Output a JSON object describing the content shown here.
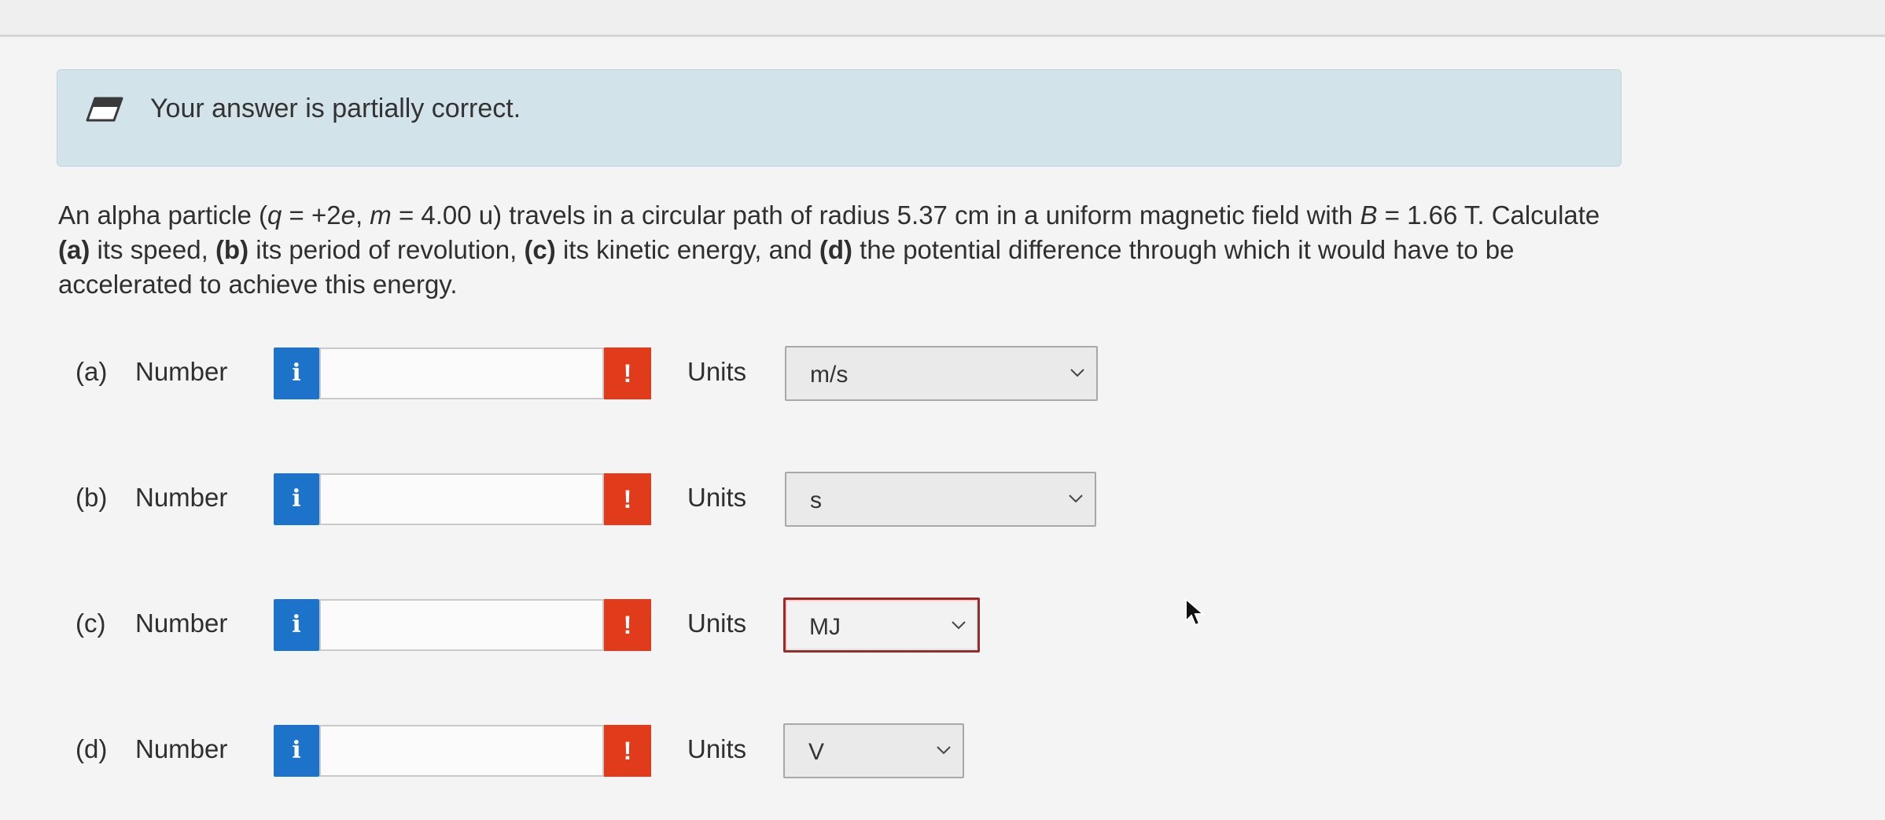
{
  "notice": {
    "icon": "pencil-eraser-icon",
    "message": "Your answer is partially correct."
  },
  "question": {
    "p1": "An alpha particle (",
    "q": "q",
    "p2": " = +2",
    "e": "e",
    "p3": ", ",
    "m": "m",
    "p4": " = 4.00 u) travels in a circular path of radius 5.37 cm in a uniform magnetic field with ",
    "B": "B",
    "p5": " = 1.66 T. Calculate ",
    "a_tag": "(a)",
    "p6": " its speed, ",
    "b_tag": "(b)",
    "p7": " its period of revolution, ",
    "c_tag": "(c)",
    "p8": " its kinetic energy, and ",
    "d_tag": "(d)",
    "p9": " the potential difference through which it would have to be accelerated to achieve this energy."
  },
  "parts": [
    {
      "label": "(a)",
      "number_label": "Number",
      "info": "i",
      "value": "",
      "warn": "!",
      "units_label": "Units",
      "unit": "m/s"
    },
    {
      "label": "(b)",
      "number_label": "Number",
      "info": "i",
      "value": "",
      "warn": "!",
      "units_label": "Units",
      "unit": "s"
    },
    {
      "label": "(c)",
      "number_label": "Number",
      "info": "i",
      "value": "",
      "warn": "!",
      "units_label": "Units",
      "unit": "MJ"
    },
    {
      "label": "(d)",
      "number_label": "Number",
      "info": "i",
      "value": "",
      "warn": "!",
      "units_label": "Units",
      "unit": "V"
    }
  ],
  "colors": {
    "notice_bg": "#d3e3ea",
    "info_blue": "#1d73c9",
    "warn_red": "#e03c1c",
    "error_border": "#9c2a2a"
  }
}
